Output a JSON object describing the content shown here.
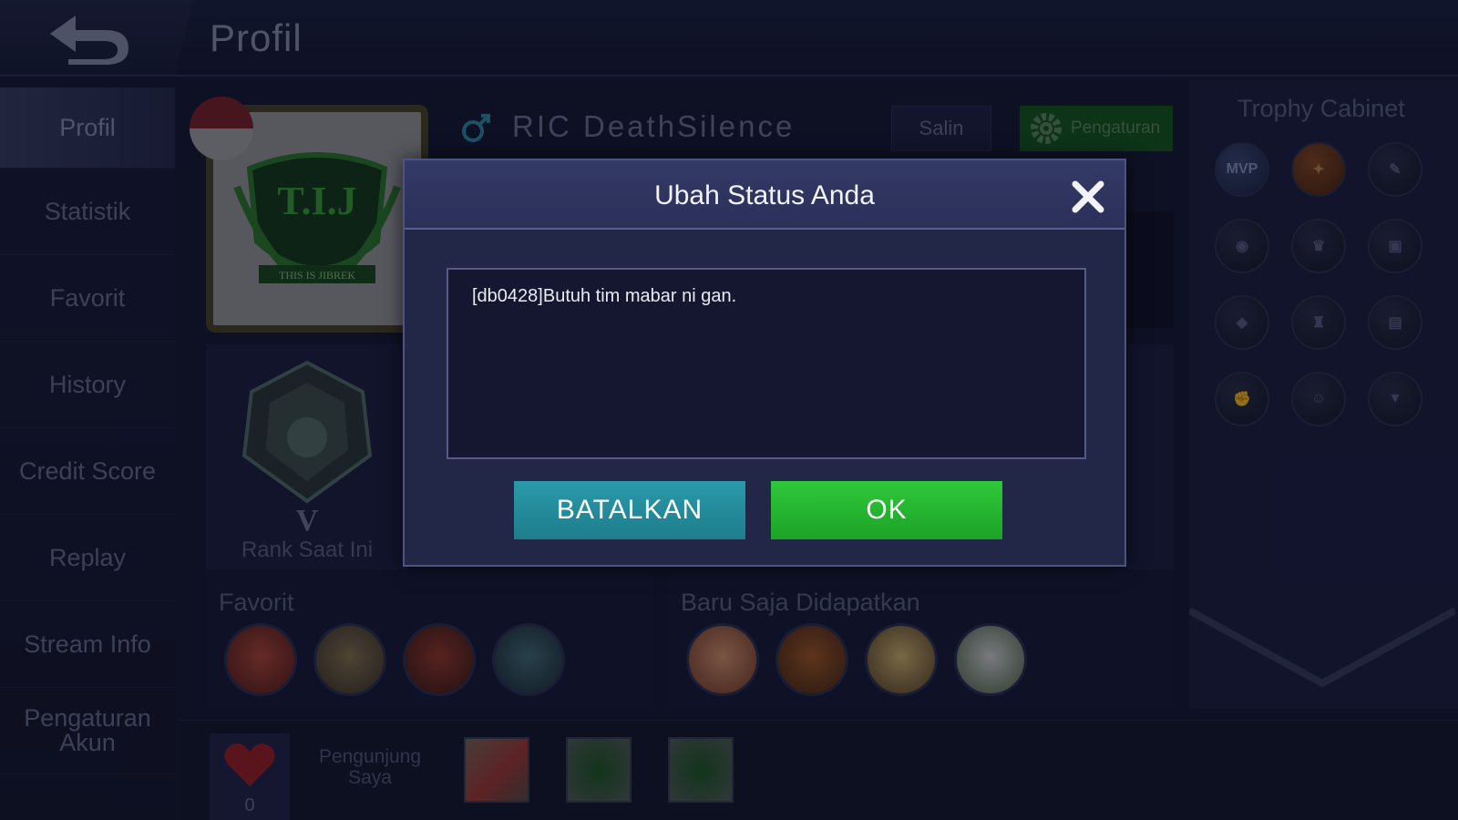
{
  "header": {
    "title": "Profil"
  },
  "sidebar": {
    "items": [
      {
        "label": "Profil",
        "active": true
      },
      {
        "label": "Statistik"
      },
      {
        "label": "Favorit"
      },
      {
        "label": "History"
      },
      {
        "label": "Credit Score"
      },
      {
        "label": "Replay"
      },
      {
        "label": "Stream Info"
      },
      {
        "label": "Pengaturan Akun"
      }
    ]
  },
  "profile": {
    "name": "RIC DeathSilence",
    "avatar_text": "T.I.J",
    "avatar_subtext": "THIS IS JIBREK",
    "copy_label": "Salin",
    "settings_label": "Pengaturan",
    "rank_tier": "V",
    "rank_label": "Rank Saat Ini"
  },
  "favorites": {
    "title": "Favorit"
  },
  "recent": {
    "title": "Baru Saja Didapatkan"
  },
  "visitors": {
    "likes": "0",
    "label": "Pengunjung Saya"
  },
  "trophy_cabinet": {
    "title": "Trophy Cabinet",
    "badges": [
      "MVP",
      "",
      "",
      "",
      "",
      "",
      "",
      "",
      "",
      "",
      "",
      ""
    ]
  },
  "modal": {
    "title": "Ubah Status Anda",
    "status_text": "[db0428]Butuh tim mabar ni gan.",
    "cancel_label": "BATALKAN",
    "ok_label": "OK"
  },
  "colors": {
    "ok_button": "#22b52e",
    "cancel_button": "#2490a0",
    "modal_bg": "#232747",
    "page_bg": "#161a33"
  }
}
